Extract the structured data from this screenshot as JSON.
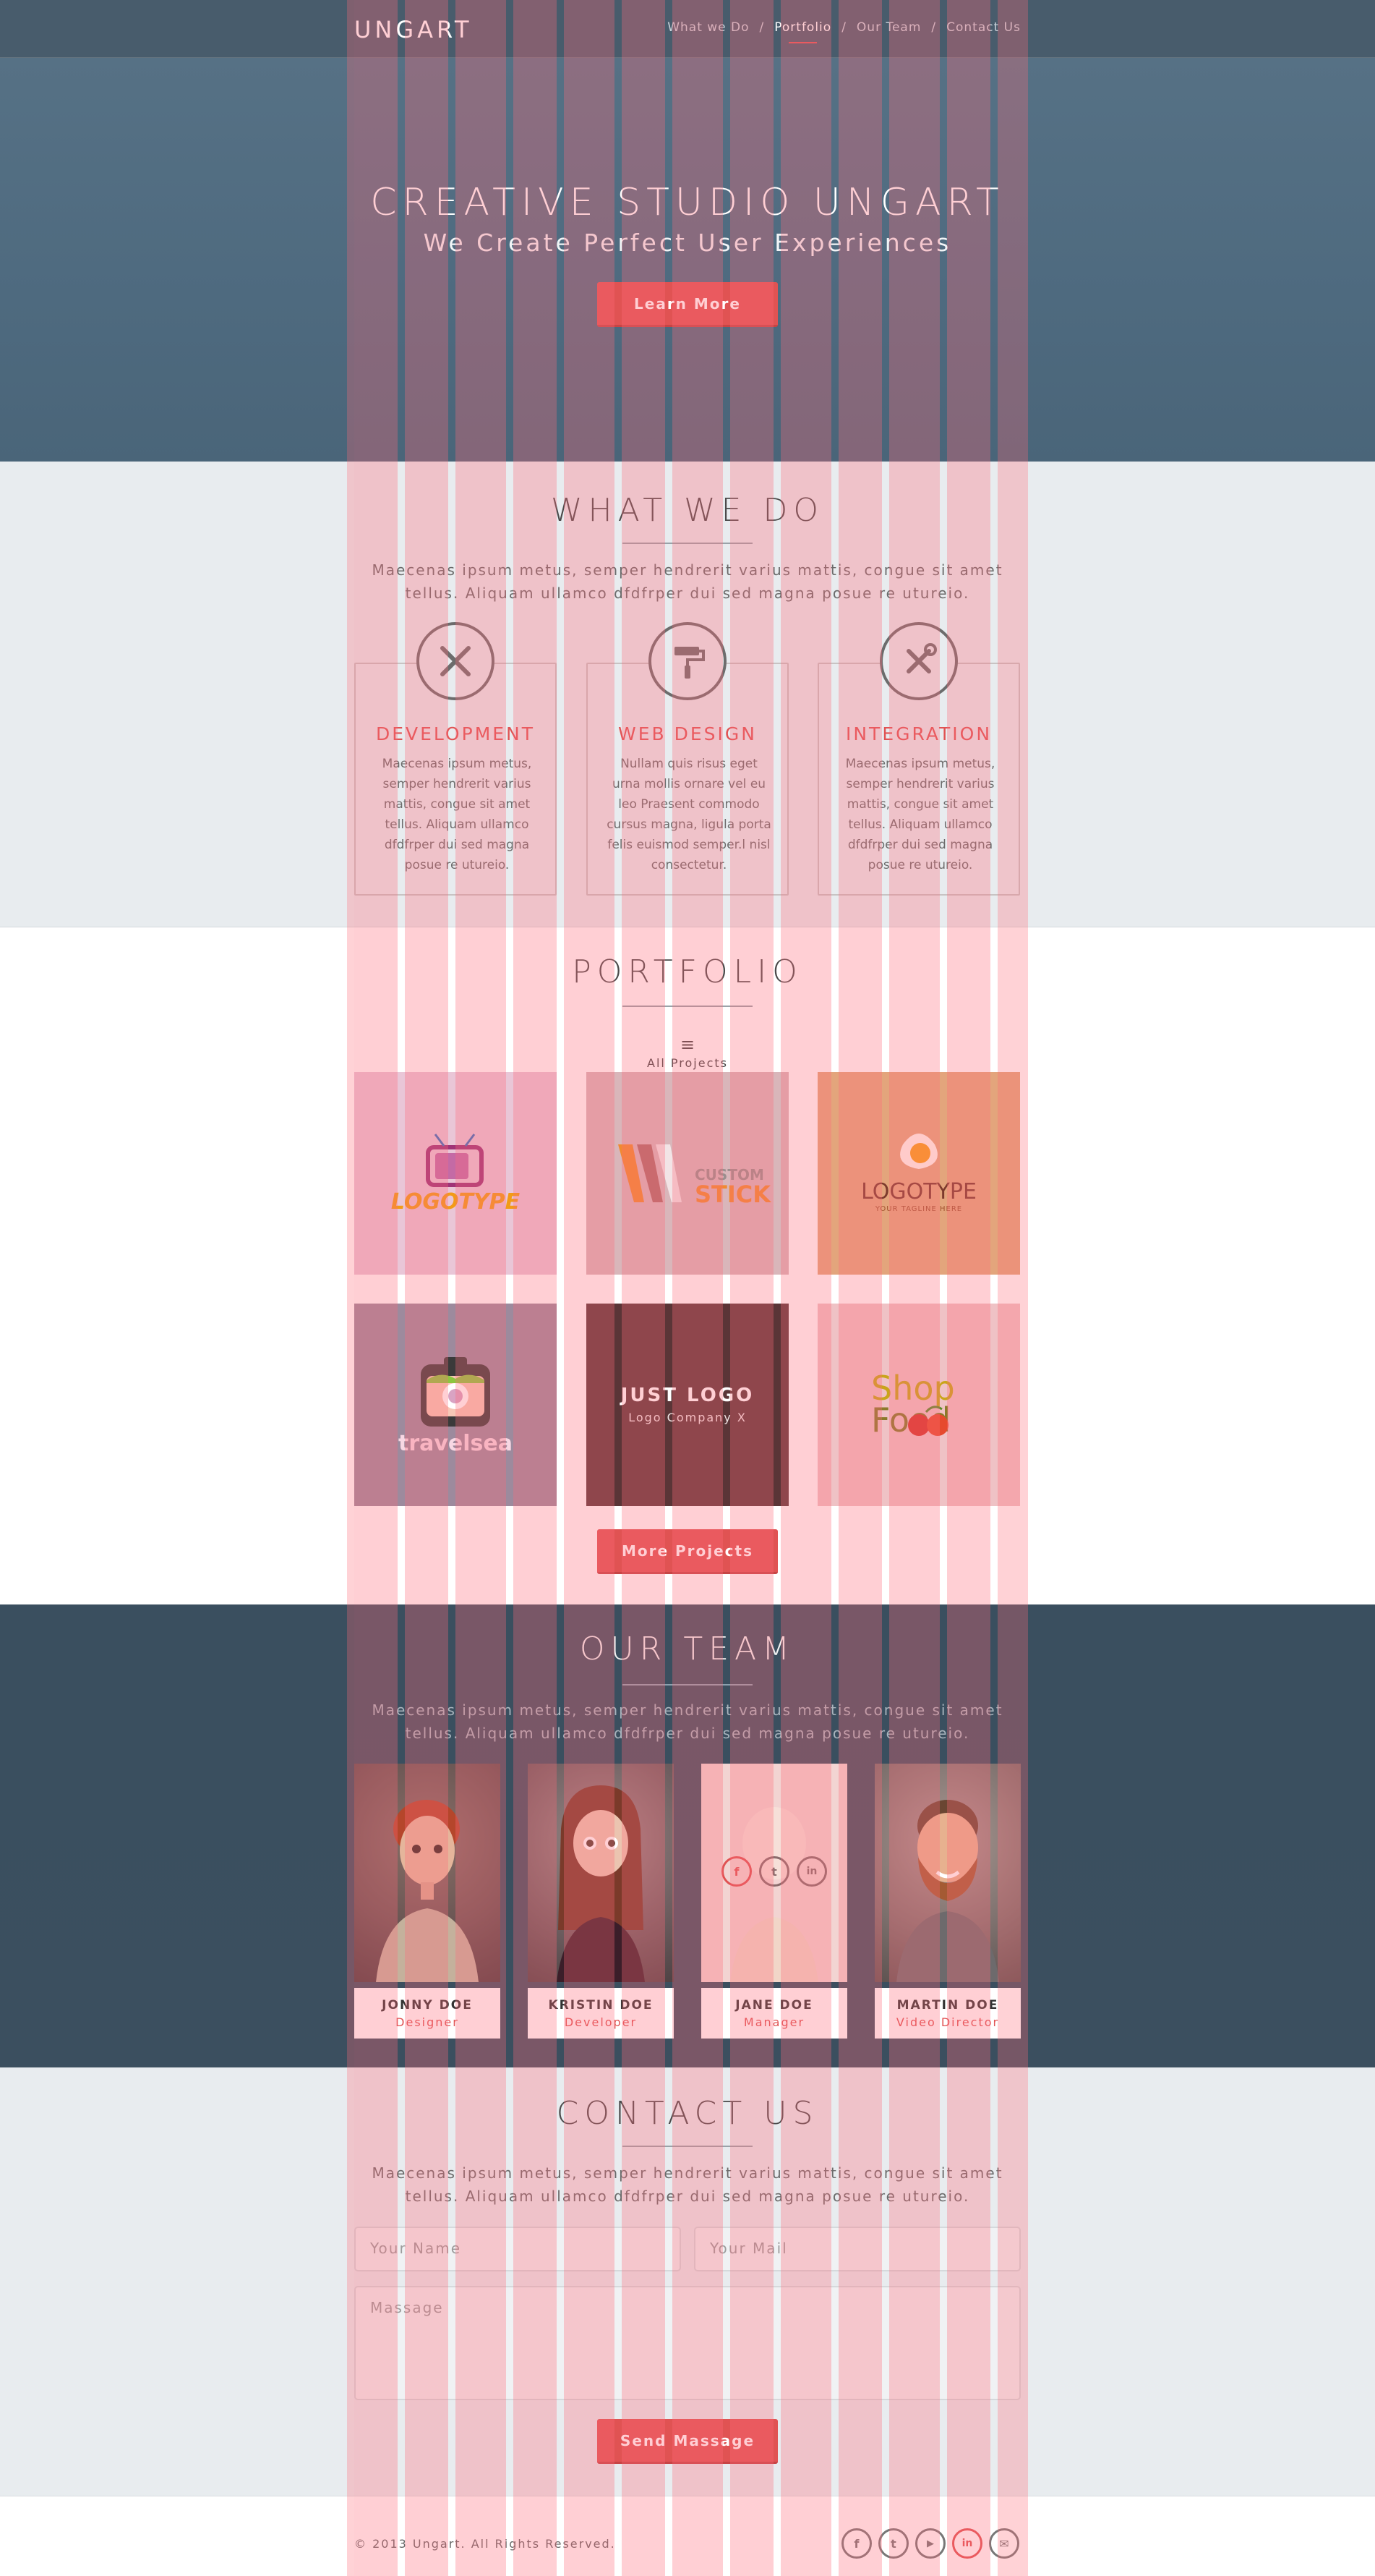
{
  "nav": {
    "logo": "UNGART",
    "menu": [
      {
        "label": "What we Do",
        "active": false
      },
      {
        "label": "Portfolio",
        "active": true
      },
      {
        "label": "Our Team",
        "active": false
      },
      {
        "label": "Contact Us",
        "active": false
      }
    ],
    "separator": "/"
  },
  "hero": {
    "title": "CREATIVE STUDIO UNGART",
    "subtitle": "We Create Perfect User Experiences",
    "button": "Learn More"
  },
  "whatwedo": {
    "title": "WHAT WE DO",
    "description": "Maecenas ipsum metus, semper hendrerit varius mattis, congue sit amet tellus. Aliquam ullamco dfdfrper dui sed magna posue re utureio.",
    "services": [
      {
        "icon": "pencil-ruler-icon",
        "title": "DEVELOPMENT",
        "text": "Maecenas ipsum metus, semper hendrerit varius mattis, congue sit amet tellus. Aliquam ullamco dfdfrper dui sed magna posue re utureio."
      },
      {
        "icon": "paint-roller-icon",
        "title": "WEB DESIGN",
        "text": "Nullam quis risus eget urna mollis ornare vel eu leo Praesent commodo cursus magna, ligula porta felis euismod semper.l nisl consectetur."
      },
      {
        "icon": "wrench-screwdriver-icon",
        "title": "INTEGRATION",
        "text": "Maecenas ipsum metus, semper hendrerit varius mattis, congue sit amet tellus. Aliquam ullamco dfdfrper dui sed magna posue re utureio."
      }
    ]
  },
  "portfolio": {
    "title": "PORTFOLIO",
    "filter_label": "All Projects",
    "items": [
      {
        "text": "LOGOTYPE",
        "bg": "#e9c6d7"
      },
      {
        "text": "CUSTOM",
        "text2": "STICK",
        "bg": "#d9b6ba"
      },
      {
        "text": "LOGOTYPE",
        "text2": "YOUR TAGLINE HERE",
        "bg": "#e3a57c"
      },
      {
        "text": "travelsea",
        "bg": "#9d8a9d"
      },
      {
        "text": "JUST LOGO",
        "text2": "Logo Company X",
        "bg": "#5a3537"
      },
      {
        "text": "Shop",
        "text2": "Food",
        "bg": "#efc2c5"
      }
    ],
    "button": "More Projects"
  },
  "team": {
    "title": "OUR TEAM",
    "description": "Maecenas ipsum metus, semper hendrerit varius mattis, congue sit amet tellus. Aliquam ullamco dfdfrper dui sed magna posue re utureio.",
    "members": [
      {
        "name": "JONNY DOE",
        "role": "Designer"
      },
      {
        "name": "KRISTIN DOE",
        "role": "Developer"
      },
      {
        "name": "JANE DOE",
        "role": "Manager"
      },
      {
        "name": "MARTIN DOE",
        "role": "Video Director"
      }
    ],
    "hover_social": [
      "f",
      "t",
      "in"
    ]
  },
  "contact": {
    "title": "CONTACT US",
    "description": "Maecenas ipsum metus, semper hendrerit varius mattis, congue sit amet tellus. Aliquam ullamco dfdfrper dui sed magna posue re utureio.",
    "name_placeholder": "Your Name",
    "mail_placeholder": "Your Mail",
    "message_placeholder": "Massage",
    "button": "Send Massage"
  },
  "footer": {
    "copyright": "© 2013 Ungart. All Rights Reserved.",
    "social": [
      {
        "icon": "facebook-icon",
        "glyph": "f"
      },
      {
        "icon": "twitter-icon",
        "glyph": "t"
      },
      {
        "icon": "youtube-icon",
        "glyph": "▶"
      },
      {
        "icon": "linkedin-icon",
        "glyph": "in"
      },
      {
        "icon": "mail-icon",
        "glyph": "✉"
      }
    ]
  },
  "colors": {
    "accent": "#e05353",
    "nav_bg": "#485c6c",
    "hero_bg": "#4e6a7f",
    "team_bg": "#3a4f5f",
    "light_bg": "#e8ecef",
    "grid_overlay": "#ff6978"
  }
}
